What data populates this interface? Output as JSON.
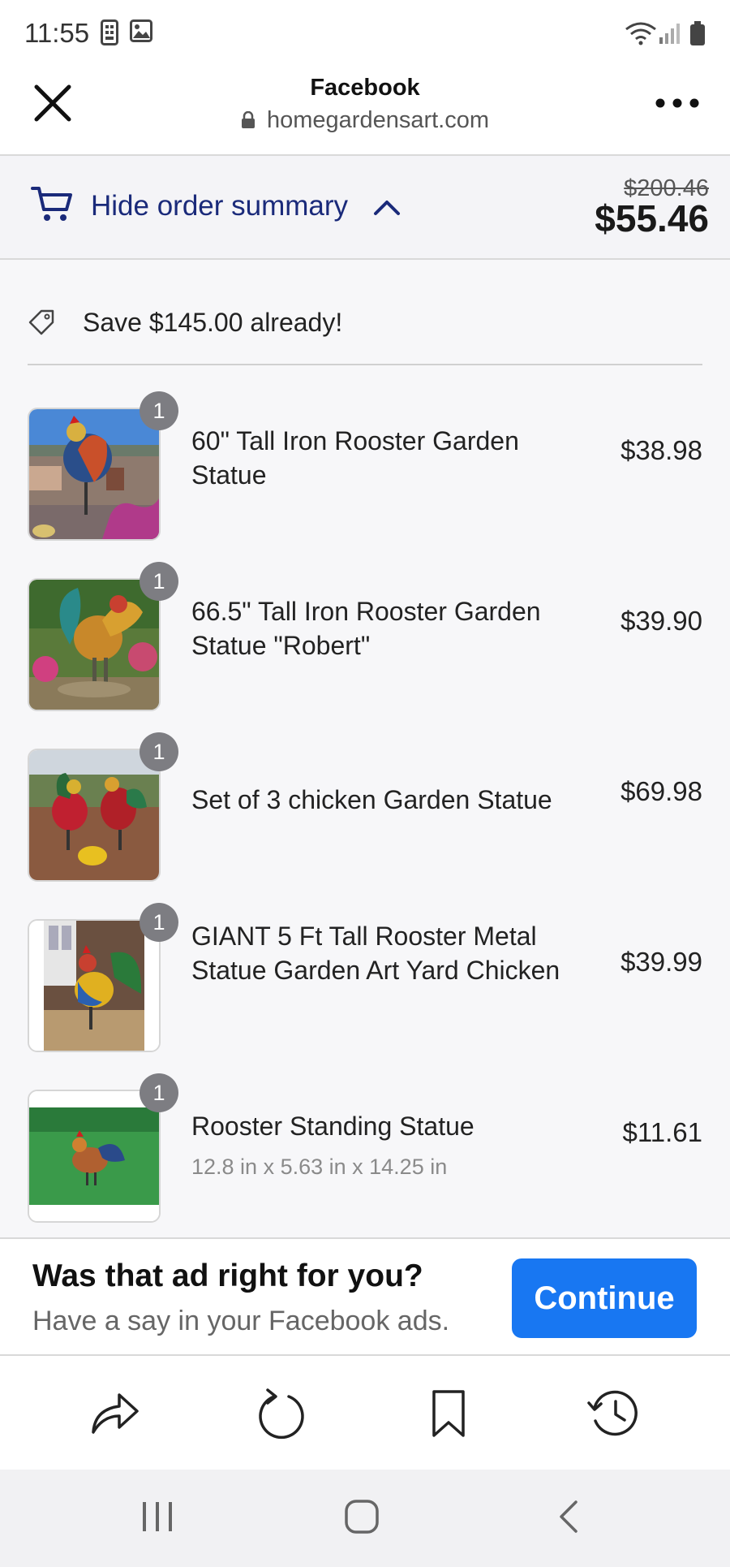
{
  "status": {
    "time": "11:55"
  },
  "browser": {
    "title": "Facebook",
    "url": "homegardensart.com"
  },
  "summary": {
    "toggle_label": "Hide order summary",
    "old_price": "$200.46",
    "total": "$55.46"
  },
  "savings": {
    "text": "Save $145.00 already!"
  },
  "items": [
    {
      "qty": "1",
      "name": "60\" Tall Iron Rooster Garden Statue",
      "price": "$38.98"
    },
    {
      "qty": "1",
      "name": "66.5\" Tall Iron Rooster Garden Statue \"Robert\"",
      "price": "$39.90"
    },
    {
      "qty": "1",
      "name": "Set of 3 chicken Garden Statue",
      "price": "$69.98"
    },
    {
      "qty": "1",
      "name": "GIANT 5 Ft Tall Rooster Metal Statue Garden Art Yard Chicken",
      "price": "$39.99"
    },
    {
      "qty": "1",
      "name": "Rooster Standing Statue",
      "subtitle": "12.8 in x 5.63 in x 14.25 in",
      "price": "$11.61"
    }
  ],
  "ad_prompt": {
    "title": "Was that ad right for you?",
    "subtitle": "Have a say in your Facebook ads.",
    "button": "Continue"
  },
  "colors": {
    "accent": "#1877f2",
    "summary_text": "#1a2a7a",
    "badge": "#7d7d82"
  },
  "icons": {
    "toolbar": [
      "share-icon",
      "refresh-icon",
      "bookmark-icon",
      "history-icon"
    ],
    "nav": [
      "recent-apps-icon",
      "home-icon",
      "back-icon"
    ]
  }
}
